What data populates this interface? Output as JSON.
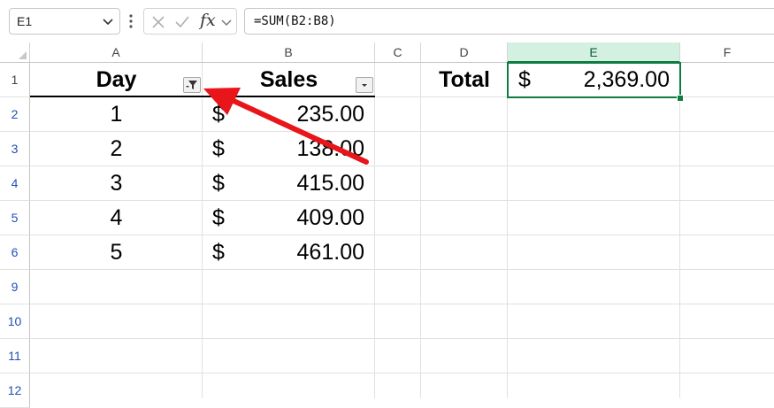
{
  "formula_bar": {
    "name_box": "E1",
    "cancel_icon": "close-icon",
    "enter_icon": "checkmark-icon",
    "fx_label": "fx",
    "formula": "=SUM(B2:B8)"
  },
  "columns": [
    "A",
    "B",
    "C",
    "D",
    "E",
    "F"
  ],
  "rows": [
    "1",
    "2",
    "3",
    "4",
    "5",
    "6",
    "9",
    "10",
    "11",
    "12"
  ],
  "table": {
    "headers": [
      "Day",
      "Sales"
    ],
    "currency_symbol": "$",
    "rows": [
      {
        "day": "1",
        "sales": "235.00"
      },
      {
        "day": "2",
        "sales": "138.00"
      },
      {
        "day": "3",
        "sales": "415.00"
      },
      {
        "day": "4",
        "sales": "409.00"
      },
      {
        "day": "5",
        "sales": "461.00"
      }
    ]
  },
  "total": {
    "label": "Total",
    "currency_symbol": "$",
    "value": "2,369.00"
  },
  "colors": {
    "selection": "#107c41",
    "row_header_text": "#1f4fb5",
    "annotation_arrow": "#e8151b"
  },
  "annotation": {
    "type": "arrow",
    "points_to": "day-filter-button"
  }
}
